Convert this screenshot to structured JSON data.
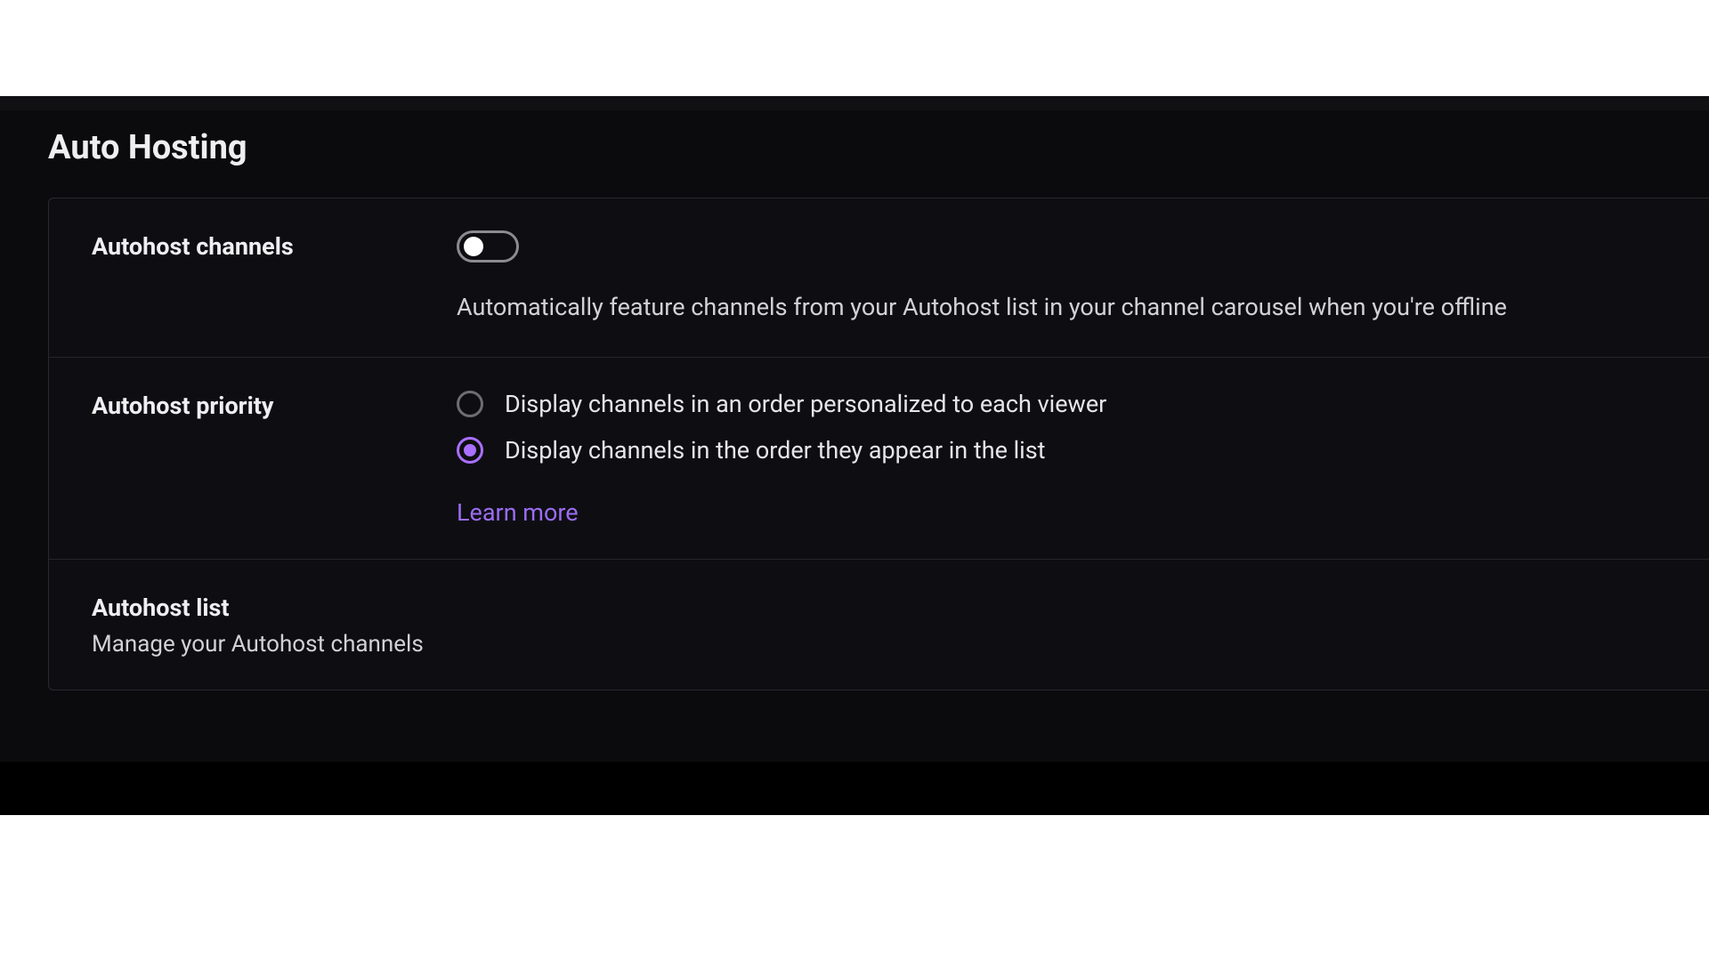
{
  "section": {
    "title": "Auto Hosting"
  },
  "autohost_channels": {
    "label": "Autohost channels",
    "description": "Automatically feature channels from your Autohost list in your channel carousel when you're offline",
    "enabled": false
  },
  "autohost_priority": {
    "label": "Autohost priority",
    "options": [
      {
        "label": "Display channels in an order personalized to each viewer",
        "selected": false
      },
      {
        "label": "Display channels in the order they appear in the list",
        "selected": true
      }
    ],
    "learn_more": "Learn more"
  },
  "autohost_list": {
    "label": "Autohost list",
    "sublabel": "Manage your Autohost channels"
  },
  "colors": {
    "accent": "#a970ff",
    "link": "#9b6cf2",
    "bg_dark": "#0b0b0e",
    "panel": "#0e0e12",
    "text": "#efeff1"
  }
}
